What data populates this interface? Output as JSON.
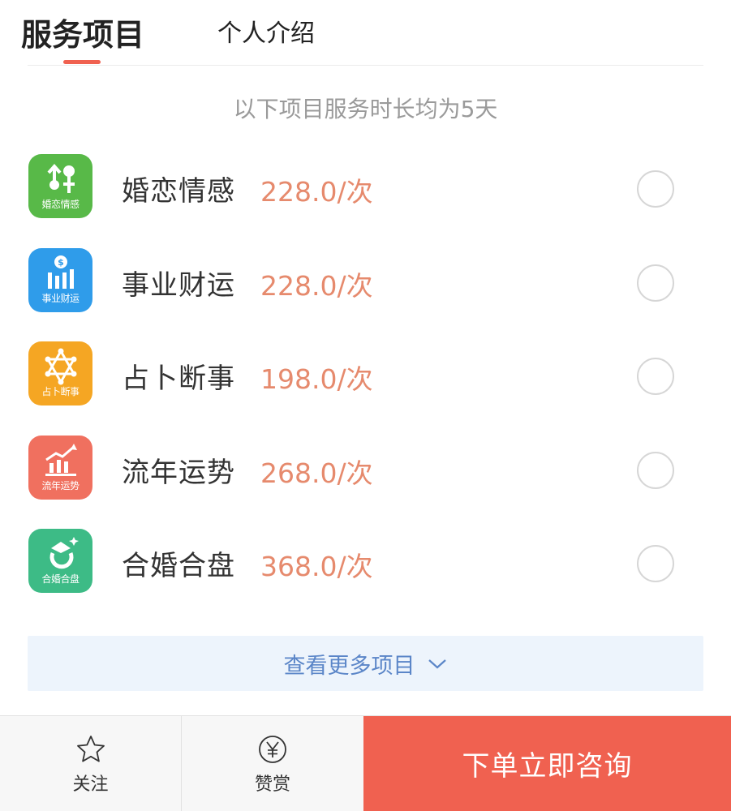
{
  "tabs": {
    "active": "服务项目",
    "inactive": "个人介绍"
  },
  "note": "以下项目服务时长均为5天",
  "services": [
    {
      "name": "婚恋情感",
      "price": "228.0/次",
      "icon_caption": "婚恋情感",
      "icon": "couple-icon",
      "color": "#58b948"
    },
    {
      "name": "事业财运",
      "price": "228.0/次",
      "icon_caption": "事业财运",
      "icon": "money-chart-icon",
      "color": "#2f9cea"
    },
    {
      "name": "占卜断事",
      "price": "198.0/次",
      "icon_caption": "占卜断事",
      "icon": "hexagram-icon",
      "color": "#f5a623"
    },
    {
      "name": "流年运势",
      "price": "268.0/次",
      "icon_caption": "流年运势",
      "icon": "trend-chart-icon",
      "color": "#f0705f"
    },
    {
      "name": "合婚合盘",
      "price": "368.0/次",
      "icon_caption": "合婚合盘",
      "icon": "rings-icon",
      "color": "#3dbb86"
    }
  ],
  "more": {
    "label": "查看更多项目"
  },
  "bottom_bar": {
    "follow_label": "关注",
    "reward_label": "赞赏",
    "order_label": "下单立即咨询"
  },
  "colors": {
    "accent": "#f06150",
    "price": "#e68a6d",
    "more_text": "#5b86c8"
  }
}
